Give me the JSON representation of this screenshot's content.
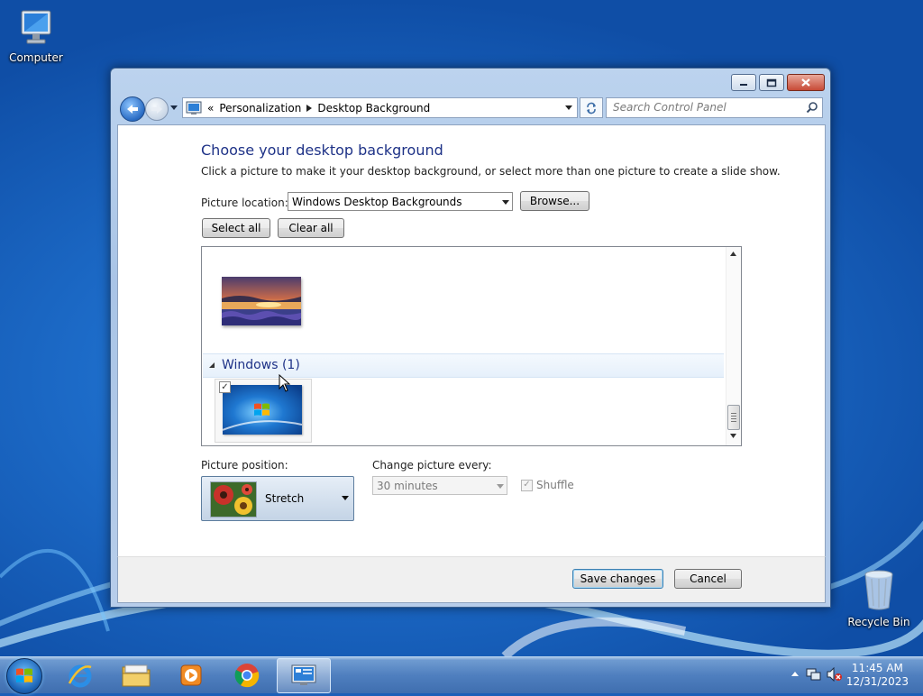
{
  "desktop": {
    "icons": [
      {
        "label": "Computer",
        "icon": "computer-icon"
      },
      {
        "label": "Recycle Bin",
        "icon": "recycle-bin-icon"
      }
    ]
  },
  "window": {
    "caption_buttons": [
      "minimize-icon",
      "maximize-icon",
      "close-icon"
    ],
    "address": {
      "overflow": "«",
      "crumbs": [
        "Personalization",
        "Desktop Background"
      ]
    },
    "search": {
      "placeholder": "Search Control Panel"
    },
    "content": {
      "title": "Choose your desktop background",
      "description": "Click a picture to make it your desktop background, or select more than one picture to create a slide show.",
      "picture_location_label": "Picture location:",
      "picture_location_value": "Windows Desktop Backgrounds",
      "browse_label": "Browse...",
      "select_all_label": "Select all",
      "clear_all_label": "Clear all",
      "gallery": {
        "group_name": "Windows (1)",
        "items": [
          {
            "name": "sunset-lake",
            "checked": false
          },
          {
            "name": "windows-logo",
            "checked": true
          }
        ]
      },
      "picture_position_label": "Picture position:",
      "picture_position_value": "Stretch",
      "change_every_label": "Change picture every:",
      "change_every_value": "30 minutes",
      "shuffle_label": "Shuffle",
      "shuffle_checked": true
    },
    "footer": {
      "save_label": "Save changes",
      "cancel_label": "Cancel"
    }
  },
  "taskbar": {
    "pinned": [
      "internet-explorer-icon",
      "file-explorer-icon",
      "media-player-icon",
      "chrome-icon",
      "control-panel-icon"
    ],
    "active": "control-panel-icon",
    "clock": {
      "time": "11:45 AM",
      "date": "12/31/2023"
    }
  }
}
